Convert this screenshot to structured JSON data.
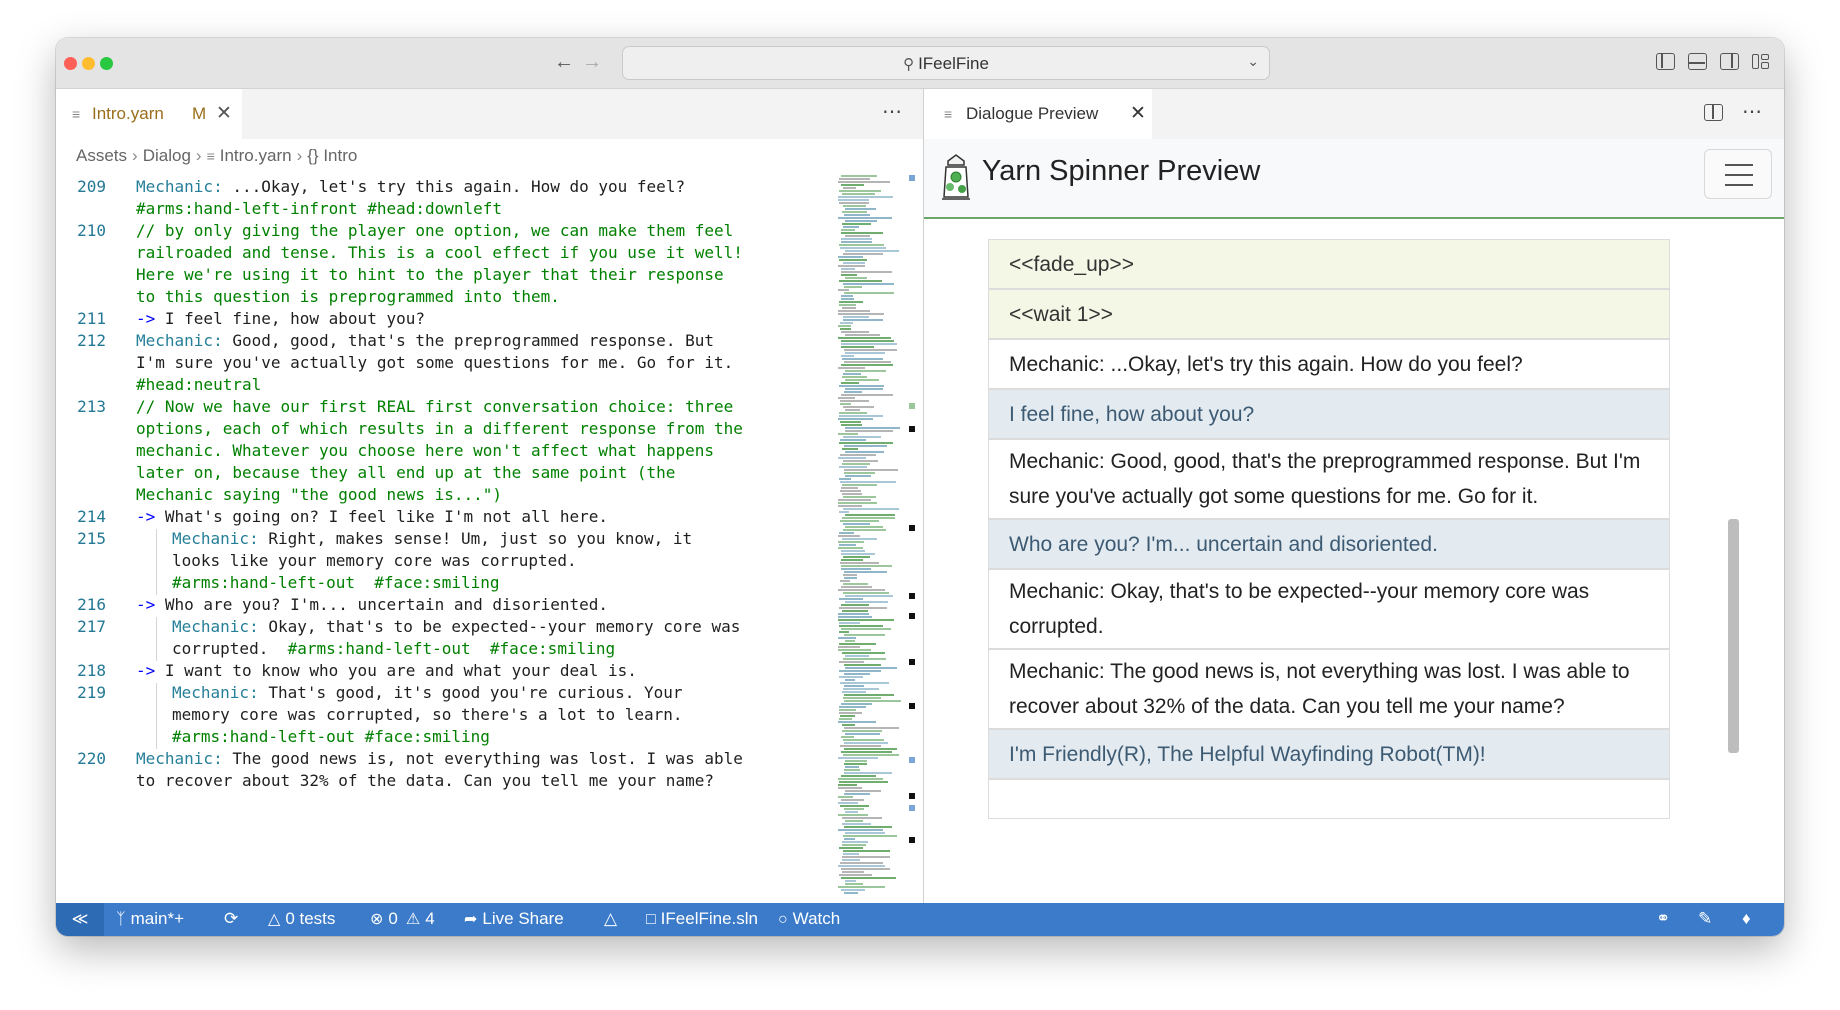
{
  "window": {
    "search_text": "IFeelFine",
    "search_icon": "search-icon",
    "dropdown_icon": "chevron-down-icon"
  },
  "editor": {
    "tab": {
      "filename": "Intro.yarn",
      "modified_badge": "M",
      "close_icon": "close-icon"
    },
    "more_actions": "⋯",
    "breadcrumb": [
      "Assets",
      "Dialog",
      "Intro.yarn",
      "{} Intro"
    ],
    "line_numbers": [
      "209",
      "210",
      "211",
      "212",
      "213",
      "214",
      "215",
      "216",
      "217",
      "218",
      "219",
      "220"
    ],
    "lines": [
      {
        "num": "209",
        "tokens": [
          {
            "t": "key",
            "v": "Mechanic:"
          },
          {
            "t": "plain",
            "v": " ...Okay, let's try this again. How do you feel?"
          }
        ]
      },
      {
        "tokens": [
          {
            "t": "tag",
            "v": "#arms:hand-left-infront #head:downleft"
          }
        ]
      },
      {
        "num": "210",
        "tokens": [
          {
            "t": "com",
            "v": "// by only giving the player one option, we can make them feel"
          }
        ]
      },
      {
        "tokens": [
          {
            "t": "com",
            "v": "railroaded and tense. This is a cool effect if you use it well!"
          }
        ]
      },
      {
        "tokens": [
          {
            "t": "com",
            "v": "Here we're using it to hint to the player that their response"
          }
        ]
      },
      {
        "tokens": [
          {
            "t": "com",
            "v": "to this question is preprogrammed into them."
          }
        ]
      },
      {
        "num": "211",
        "tokens": [
          {
            "t": "arrow",
            "v": "->"
          },
          {
            "t": "plain",
            "v": " I feel fine, how about you?"
          }
        ]
      },
      {
        "num": "212",
        "tokens": [
          {
            "t": "key",
            "v": "Mechanic:"
          },
          {
            "t": "plain",
            "v": " Good, good, that's the preprogrammed response. But"
          }
        ]
      },
      {
        "tokens": [
          {
            "t": "plain",
            "v": "I'm sure you've actually got some questions for me. Go for it."
          }
        ]
      },
      {
        "tokens": [
          {
            "t": "tag",
            "v": "#head:neutral"
          }
        ]
      },
      {
        "num": "213",
        "tokens": [
          {
            "t": "com",
            "v": "// Now we have our first REAL first conversation choice: three"
          }
        ]
      },
      {
        "tokens": [
          {
            "t": "com",
            "v": "options, each of which results in a different response from the"
          }
        ]
      },
      {
        "tokens": [
          {
            "t": "com",
            "v": "mechanic. Whatever you choose here won't affect what happens"
          }
        ]
      },
      {
        "tokens": [
          {
            "t": "com",
            "v": "later on, because they all end up at the same point (the"
          }
        ]
      },
      {
        "tokens": [
          {
            "t": "com",
            "v": "Mechanic saying \"the good news is...\")"
          }
        ]
      },
      {
        "num": "214",
        "tokens": [
          {
            "t": "arrow",
            "v": "->"
          },
          {
            "t": "plain",
            "v": " What's going on? I feel like I'm not all here."
          }
        ]
      },
      {
        "num": "215",
        "indent": true,
        "tokens": [
          {
            "t": "key",
            "v": "Mechanic:"
          },
          {
            "t": "plain",
            "v": " Right, makes sense! Um, just so you know, it"
          }
        ]
      },
      {
        "indent": true,
        "tokens": [
          {
            "t": "plain",
            "v": "looks like your memory core was corrupted."
          }
        ]
      },
      {
        "indent": true,
        "tokens": [
          {
            "t": "tag",
            "v": "#arms:hand-left-out  #face:smiling"
          }
        ]
      },
      {
        "num": "216",
        "tokens": [
          {
            "t": "arrow",
            "v": "->"
          },
          {
            "t": "plain",
            "v": " Who are you? I'm... uncertain and disoriented."
          }
        ]
      },
      {
        "num": "217",
        "indent": true,
        "tokens": [
          {
            "t": "key",
            "v": "Mechanic:"
          },
          {
            "t": "plain",
            "v": " Okay, that's to be expected--your memory core was"
          }
        ]
      },
      {
        "indent": true,
        "tokens": [
          {
            "t": "plain",
            "v": "corrupted.  "
          },
          {
            "t": "tag",
            "v": "#arms:hand-left-out  #face:smiling"
          }
        ]
      },
      {
        "num": "218",
        "tokens": [
          {
            "t": "arrow",
            "v": "->"
          },
          {
            "t": "plain",
            "v": " I want to know who you are and what your deal is."
          }
        ]
      },
      {
        "num": "219",
        "indent": true,
        "tokens": [
          {
            "t": "key",
            "v": "Mechanic:"
          },
          {
            "t": "plain",
            "v": " That's good, it's good you're curious. Your"
          }
        ]
      },
      {
        "indent": true,
        "tokens": [
          {
            "t": "plain",
            "v": "memory core was corrupted, so there's a lot to learn."
          }
        ]
      },
      {
        "indent": true,
        "tokens": [
          {
            "t": "tag",
            "v": "#arms:hand-left-out #face:smiling"
          }
        ]
      },
      {
        "num": "220",
        "tokens": [
          {
            "t": "key",
            "v": "Mechanic:"
          },
          {
            "t": "plain",
            "v": " The good news is, not everything was lost. I was able"
          }
        ]
      },
      {
        "tokens": [
          {
            "t": "plain",
            "v": "to recover about 32% of the data. Can you tell me your name?"
          }
        ]
      }
    ],
    "colors": {
      "keyword": "#267f99",
      "comment": "#008000",
      "arrow": "#0000ff",
      "line_number": "#237893"
    }
  },
  "preview": {
    "tab_label": "Dialogue Preview",
    "title": "Yarn Spinner Preview",
    "logo_icon": "yarn-spinner-logo",
    "menu_icon": "hamburger-menu-icon",
    "items": [
      {
        "kind": "cmd",
        "text": "<<fade_up>>"
      },
      {
        "kind": "cmd",
        "text": "<<wait 1>>"
      },
      {
        "kind": "txt",
        "text": "Mechanic: ...Okay, let's try this again. How do you feel?"
      },
      {
        "kind": "opt",
        "text": "I feel fine, how about you?"
      },
      {
        "kind": "txt",
        "text": "Mechanic: Good, good, that's the preprogrammed response. But I'm sure you've actually got some questions for me. Go for it."
      },
      {
        "kind": "opt",
        "text": "Who are you? I'm... uncertain and disoriented."
      },
      {
        "kind": "txt",
        "text": "Mechanic: Okay, that's to be expected--your memory core was corrupted."
      },
      {
        "kind": "txt",
        "text": "Mechanic: The good news is, not everything was lost. I was able to recover about 32% of the data. Can you tell me your name?"
      },
      {
        "kind": "opt",
        "text": "I'm Friendly(R), The Helpful Wayfinding Robot(TM)!"
      }
    ],
    "colors": {
      "command_bg": "#f4f7e6",
      "option_bg": "#e3ebf1",
      "option_text": "#3d5a73",
      "header_border": "#6aa56a"
    }
  },
  "statusbar": {
    "remote_icon": "remote-icon",
    "branch": "main*+",
    "sync_icon": "sync-icon",
    "tests": "0 tests",
    "errors": "0",
    "warnings": "4",
    "live_share": "Live Share",
    "flame_icon": "flame-icon",
    "solution": "IFeelFine.sln",
    "watch": "Watch",
    "background": "#3b7bc9"
  }
}
